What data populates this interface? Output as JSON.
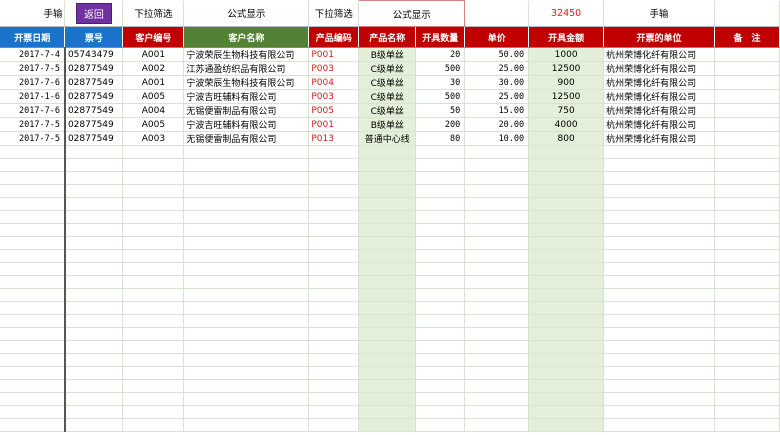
{
  "top": {
    "manual1": "手输",
    "back": "返回",
    "filter1": "下拉筛选",
    "formula1": "公式显示",
    "filter2": "下拉筛选",
    "formula2": "公式显示",
    "total": "32450",
    "manual2": "手输"
  },
  "headers": [
    "开票日期",
    "票号",
    "客户编号",
    "客户名称",
    "产品编码",
    "产品名称",
    "开具数量",
    "单价",
    "开具金额",
    "开票的单位",
    "备　注"
  ],
  "rows": [
    [
      "2017-7-4",
      "05743479",
      "A001",
      "宁波荣辰生物科技有限公司",
      "P001",
      "B级单丝",
      "20",
      "50.00",
      "1000",
      "杭州荣博化纤有限公司",
      ""
    ],
    [
      "2017-7-5",
      "02877549",
      "A002",
      "江苏通盈纺织品有限公司",
      "P003",
      "C级单丝",
      "500",
      "25.00",
      "12500",
      "杭州荣博化纤有限公司",
      ""
    ],
    [
      "2017-7-6",
      "02877549",
      "A001",
      "宁波荣辰生物科技有限公司",
      "P004",
      "C级单丝",
      "30",
      "30.00",
      "900",
      "杭州荣博化纤有限公司",
      ""
    ],
    [
      "2017-1-6",
      "02877549",
      "A005",
      "宁波吉旺辅料有限公司",
      "P003",
      "C级单丝",
      "500",
      "25.00",
      "12500",
      "杭州荣博化纤有限公司",
      ""
    ],
    [
      "2017-7-6",
      "02877549",
      "A004",
      "无锡便雷制品有限公司",
      "P005",
      "C级单丝",
      "50",
      "15.00",
      "750",
      "杭州荣博化纤有限公司",
      ""
    ],
    [
      "2017-7-5",
      "02877549",
      "A005",
      "宁波吉旺辅料有限公司",
      "P001",
      "B级单丝",
      "200",
      "20.00",
      "4000",
      "杭州荣博化纤有限公司",
      ""
    ],
    [
      "2017-7-5",
      "02877549",
      "A003",
      "无锡便雷制品有限公司",
      "P013",
      "普通中心线",
      "80",
      "10.00",
      "800",
      "杭州荣博化纤有限公司",
      ""
    ]
  ]
}
